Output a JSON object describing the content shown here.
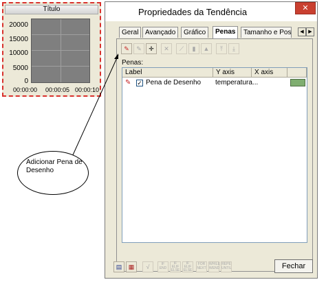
{
  "trend": {
    "title": "Título",
    "y_ticks": [
      "20000",
      "15000",
      "10000",
      "5000",
      "0"
    ],
    "x_ticks": [
      "00:00:00",
      "00:00:05",
      "00:00:10"
    ]
  },
  "dialog": {
    "title": "Propriedades da Tendência",
    "close_icon": "close-icon",
    "tabs": [
      {
        "label": "Geral"
      },
      {
        "label": "Avançado"
      },
      {
        "label": "Gráfico"
      },
      {
        "label": "Penas"
      },
      {
        "label": "Tamanho e Pos"
      }
    ],
    "active_tab": "Penas",
    "tab_scroll_left": "◀",
    "tab_scroll_right": "▶",
    "toolbar": {
      "icons": [
        "add-pen-icon",
        "edit-pen-icon",
        "move-icon",
        "delete-icon",
        "line-style-icon",
        "bar-chart-icon",
        "area-chart-icon",
        "move-up-icon",
        "move-down-icon"
      ]
    },
    "penas_label": "Penas:",
    "list": {
      "columns": [
        "Label",
        "Y axis",
        "X axis",
        ""
      ],
      "rows": [
        {
          "label": "Pena de Desenho",
          "y_axis": "temperatura...",
          "x_axis": "",
          "checked": true,
          "color": "#7fae70"
        }
      ]
    },
    "bottom_toolbar": {
      "icons": [
        "object-icon-1",
        "object-icon-2",
        "function-icon"
      ],
      "labels": [
        "IF\nEND",
        "IF\nELIF\nELSE",
        "IF\nELIF\nELSE",
        "FOR\nNEXT",
        "WHILE\nWEND",
        "REPE\nUNTIL"
      ]
    },
    "close_button": "Fechar"
  },
  "callout": {
    "text": "Adicionar Pena de Desenho"
  },
  "colors": {
    "accent_red": "#d9302c",
    "pen_color": "#7fae70",
    "close_button": "#c94030"
  }
}
